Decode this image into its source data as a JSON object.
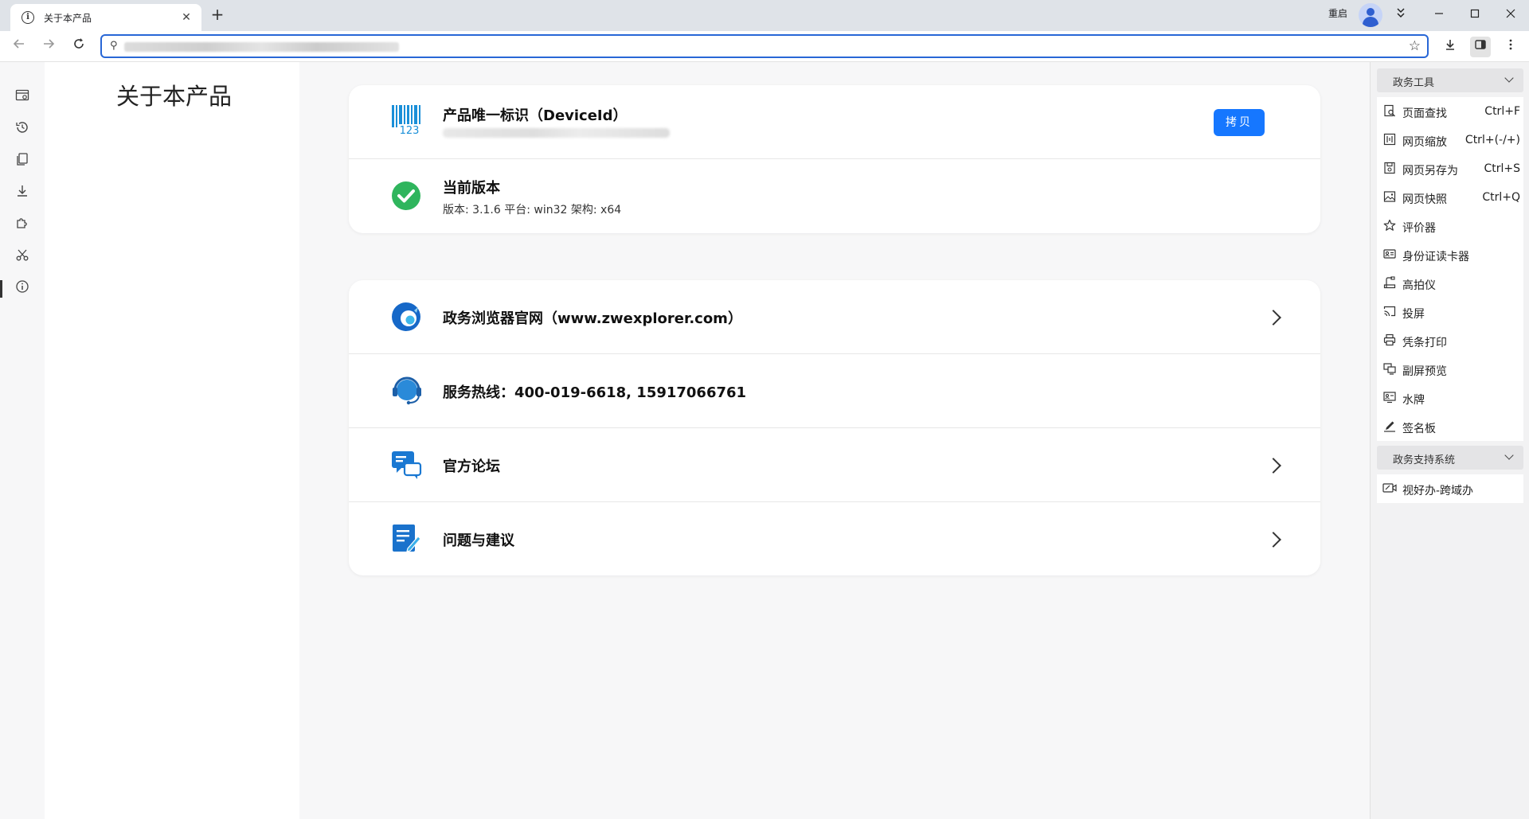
{
  "browser": {
    "tab": {
      "title": "关于本产品",
      "icon": "info-icon"
    },
    "restart_label": "重启",
    "window_controls": [
      "minimize",
      "maximize",
      "close"
    ]
  },
  "toolbar": {
    "back_icon": "arrow-left-icon",
    "forward_icon": "arrow-right-icon",
    "reload_icon": "reload-icon",
    "address_value": ""
  },
  "rail": {
    "items": [
      "settings",
      "history",
      "bookmarks",
      "downloads",
      "extensions",
      "tools",
      "about"
    ]
  },
  "left_panel": {
    "title": "关于本产品"
  },
  "product_card": {
    "device_id": {
      "title": "产品唯一标识（DeviceId）",
      "copy_label": "拷贝"
    },
    "version": {
      "title": "当前版本",
      "detail": "版本: 3.1.6 平台: win32 架构: x64"
    }
  },
  "links_card": {
    "items": [
      {
        "title": "政务浏览器官网（www.zwexplorer.com）",
        "icon": "browser-logo-icon",
        "has_chevron": true
      },
      {
        "title": "服务热线：400-019-6618, 15917066761",
        "icon": "headset-icon",
        "has_chevron": false
      },
      {
        "title": "官方论坛",
        "icon": "chat-bubbles-icon",
        "has_chevron": true
      },
      {
        "title": "问题与建议",
        "icon": "feedback-doc-icon",
        "has_chevron": true
      }
    ]
  },
  "right_panel": {
    "section1": {
      "label": "政务工具",
      "items": [
        {
          "label": "页面查找",
          "shortcut": "Ctrl+F",
          "icon": "page-search-icon"
        },
        {
          "label": "网页缩放",
          "shortcut": "Ctrl+(-/+)",
          "icon": "zoom-icon"
        },
        {
          "label": "网页另存为",
          "shortcut": "Ctrl+S",
          "icon": "save-as-icon"
        },
        {
          "label": "网页快照",
          "shortcut": "Ctrl+Q",
          "icon": "snapshot-icon"
        },
        {
          "label": "评价器",
          "shortcut": "",
          "icon": "star-outline-icon"
        },
        {
          "label": "身份证读卡器",
          "shortcut": "",
          "icon": "id-card-icon"
        },
        {
          "label": "高拍仪",
          "shortcut": "",
          "icon": "document-camera-icon"
        },
        {
          "label": "投屏",
          "shortcut": "",
          "icon": "cast-icon"
        },
        {
          "label": "凭条打印",
          "shortcut": "",
          "icon": "printer-icon"
        },
        {
          "label": "副屏预览",
          "shortcut": "",
          "icon": "dual-screen-icon"
        },
        {
          "label": "水牌",
          "shortcut": "",
          "icon": "nameplate-icon"
        },
        {
          "label": "签名板",
          "shortcut": "",
          "icon": "pen-icon"
        }
      ]
    },
    "section2": {
      "label": "政务支持系统",
      "items": [
        {
          "label": "视好办-跨域办",
          "shortcut": "",
          "icon": "video-service-icon"
        }
      ]
    }
  }
}
